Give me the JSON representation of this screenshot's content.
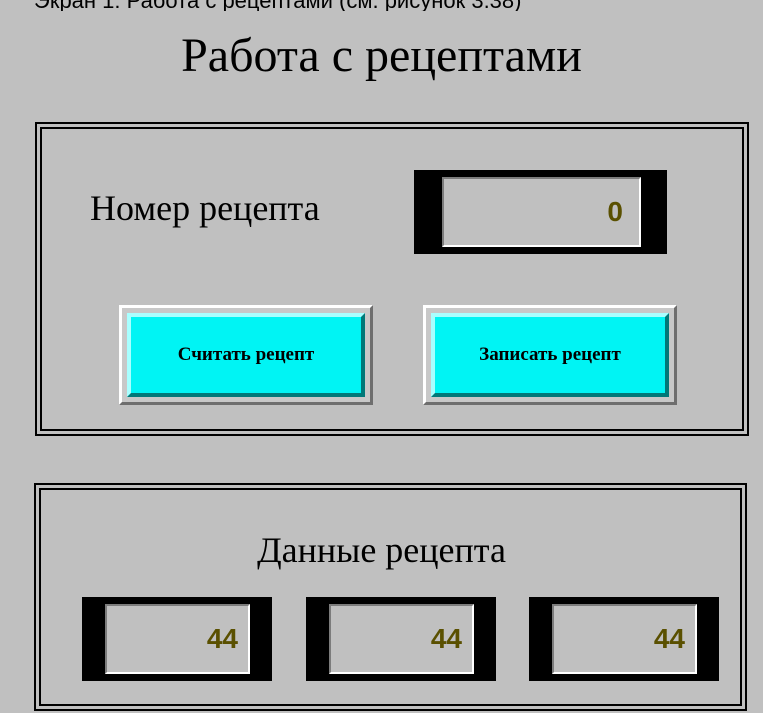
{
  "top_clipped_text": "Экран 1: Работа с рецептами (см. рисунок 3.38)",
  "screen_title": "Работа с рецептами",
  "recipe_panel": {
    "number_label": "Номер рецепта",
    "number_value": "0",
    "read_button_label": "Считать рецепт",
    "write_button_label": "Записать рецепт"
  },
  "data_panel": {
    "title": "Данные рецепта",
    "values": [
      "44",
      "44",
      "44"
    ]
  },
  "colors": {
    "background": "#c0c0c0",
    "button_face": "#00f4f4",
    "value_text": "#5a5000"
  }
}
